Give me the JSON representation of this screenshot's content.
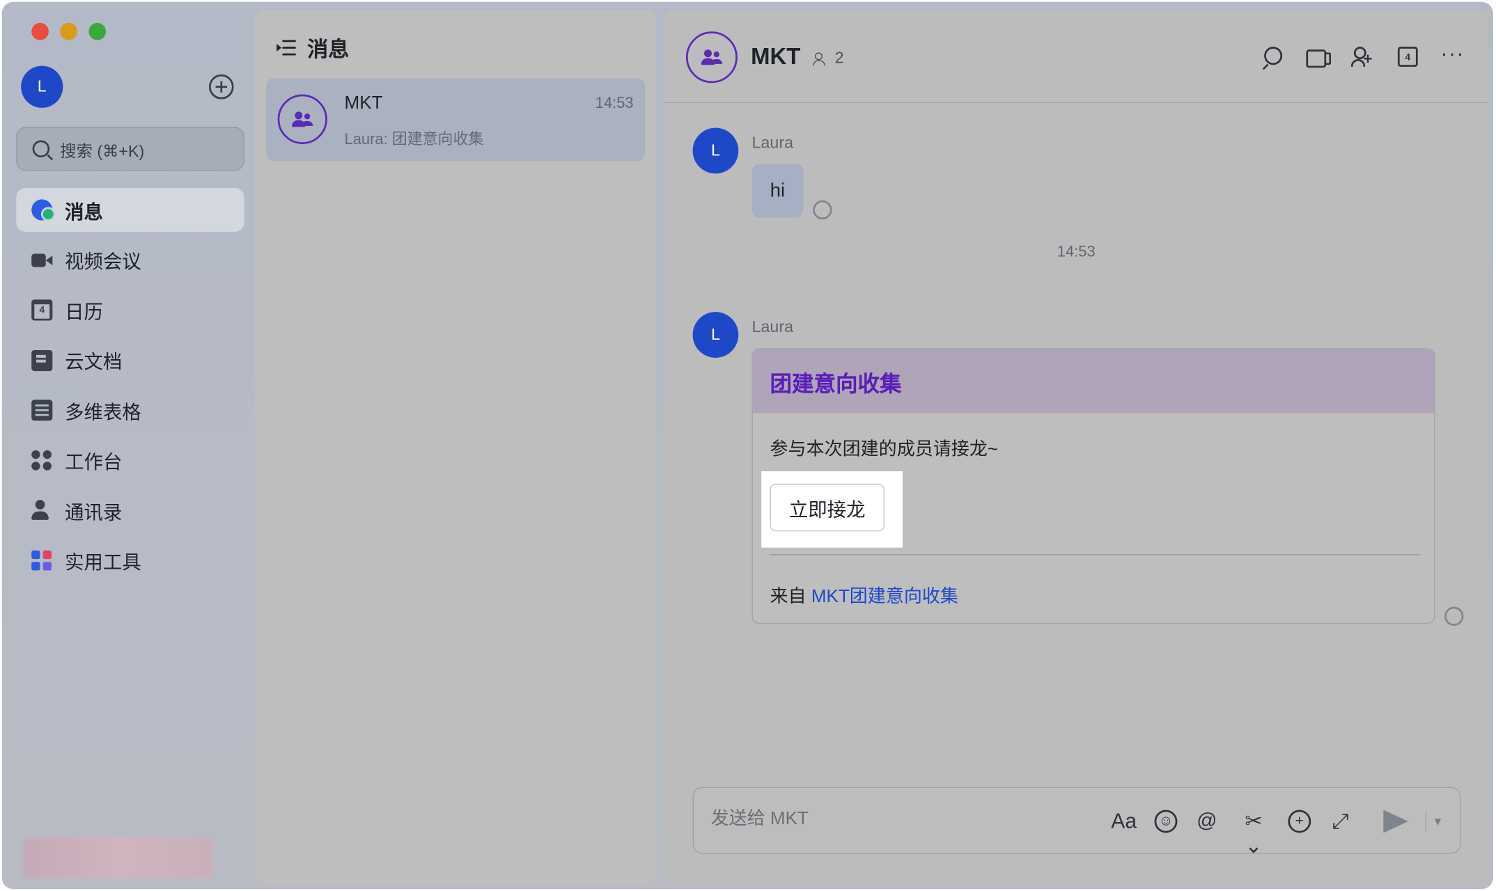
{
  "sidebar": {
    "user_initial": "L",
    "search_placeholder": "搜索 (⌘+K)",
    "items": [
      {
        "label": "消息",
        "icon": "message-icon",
        "active": true
      },
      {
        "label": "视频会议",
        "icon": "video-icon"
      },
      {
        "label": "日历",
        "icon": "calendar-icon"
      },
      {
        "label": "云文档",
        "icon": "document-icon"
      },
      {
        "label": "多维表格",
        "icon": "table-icon"
      },
      {
        "label": "工作台",
        "icon": "workplace-icon"
      },
      {
        "label": "通讯录",
        "icon": "contacts-icon"
      },
      {
        "label": "实用工具",
        "icon": "tools-icon"
      }
    ]
  },
  "message_list": {
    "title": "消息",
    "conversations": [
      {
        "name": "MKT",
        "time": "14:53",
        "preview": "Laura: 团建意向收集"
      }
    ]
  },
  "chat": {
    "title": "MKT",
    "member_count": "2",
    "messages": [
      {
        "sender": "Laura",
        "initial": "L",
        "text": "hi"
      }
    ],
    "time_divider": "14:53",
    "card": {
      "sender": "Laura",
      "initial": "L",
      "title": "团建意向收集",
      "body": "参与本次团建的成员请接龙~",
      "button_label": "立即接龙",
      "footer_prefix": "来自",
      "footer_link": "MKT团建意向收集"
    },
    "input": {
      "placeholder": "发送给 MKT",
      "format_label": "Aa"
    }
  },
  "colors": {
    "accent_blue": "#1f48c8",
    "group_purple": "#5a1eb7",
    "presence_green": "#23b574"
  }
}
